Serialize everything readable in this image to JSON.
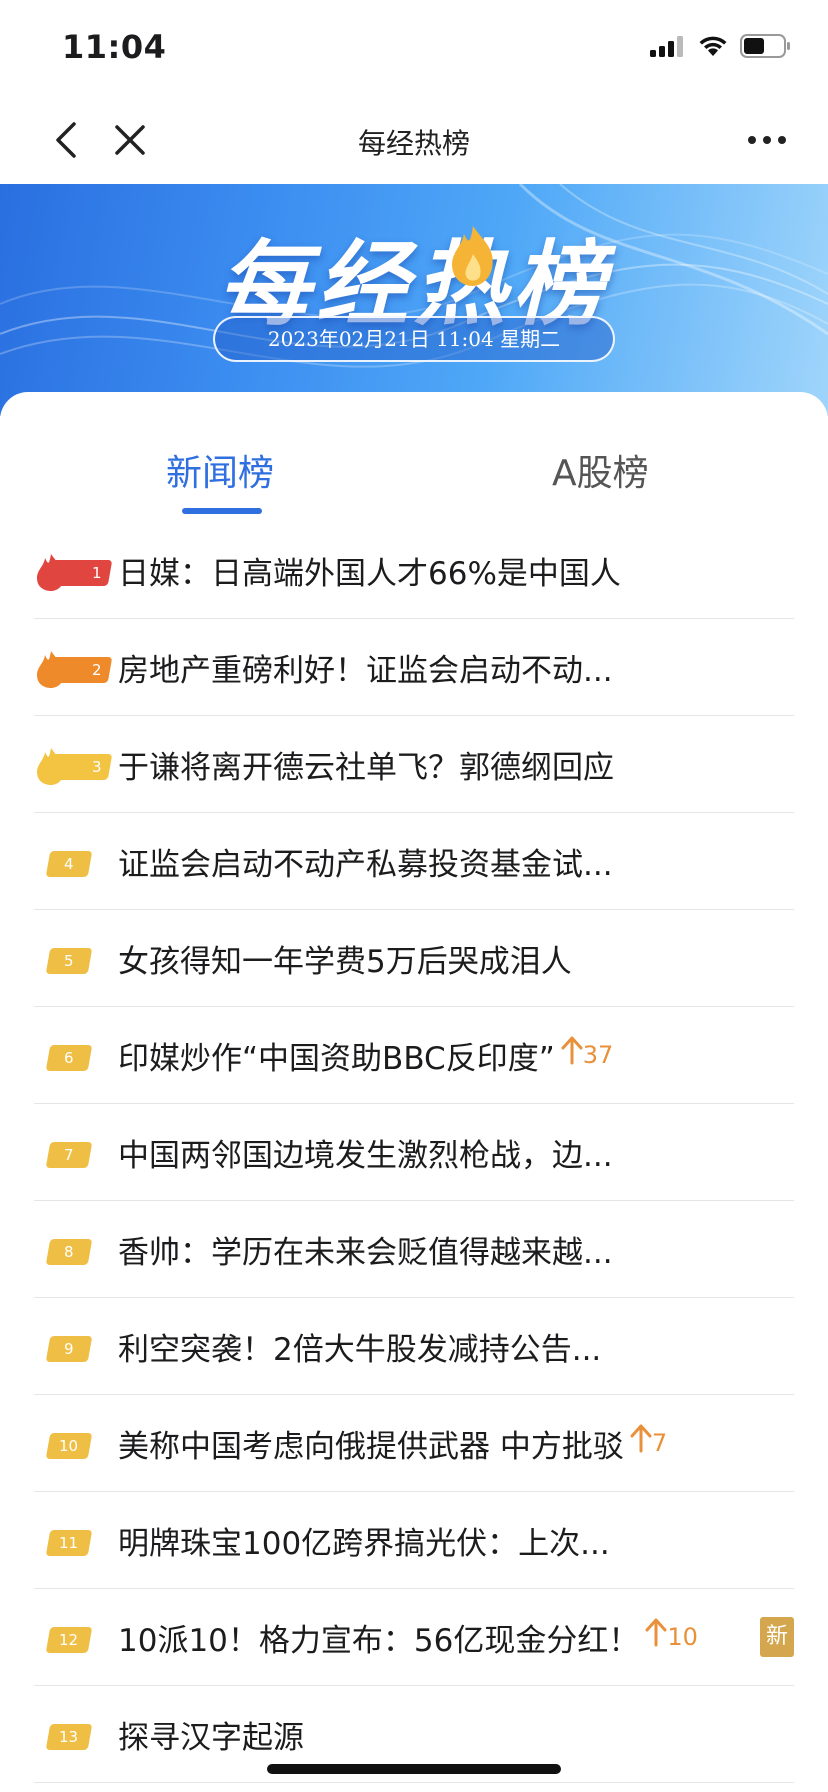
{
  "status_bar": {
    "time": "11:04"
  },
  "nav": {
    "title": "每经热榜"
  },
  "banner": {
    "title": "每经热榜",
    "date": "2023年02月21日 11:04 星期二"
  },
  "tabs": [
    {
      "label": "新闻榜",
      "active": true
    },
    {
      "label": "A股榜",
      "active": false
    }
  ],
  "items": [
    {
      "rank": "1",
      "title": "日媒：日高端外国人才66%是中国人"
    },
    {
      "rank": "2",
      "title": "房地产重磅利好！证监会启动不动..."
    },
    {
      "rank": "3",
      "title": "于谦将离开德云社单飞？郭德纲回应"
    },
    {
      "rank": "4",
      "title": "证监会启动不动产私募投资基金试..."
    },
    {
      "rank": "5",
      "title": "女孩得知一年学费5万后哭成泪人"
    },
    {
      "rank": "6",
      "title": "印媒炒作“中国资助BBC反印度”",
      "trend": "37"
    },
    {
      "rank": "7",
      "title": "中国两邻国边境发生激烈枪战，边..."
    },
    {
      "rank": "8",
      "title": "香帅：学历在未来会贬值得越来越..."
    },
    {
      "rank": "9",
      "title": "利空突袭！2倍大牛股发减持公告..."
    },
    {
      "rank": "10",
      "title": "美称中国考虑向俄提供武器 中方批驳",
      "trend": "7"
    },
    {
      "rank": "11",
      "title": "明牌珠宝100亿跨界搞光伏：上次..."
    },
    {
      "rank": "12",
      "title": "10派10！格力宣布：56亿现金分红！",
      "trend": "10",
      "badge": "新"
    },
    {
      "rank": "13",
      "title": "探寻汉字起源"
    }
  ],
  "colors": {
    "accent": "#2f6fe0",
    "rank1": "#e0453f",
    "rank2": "#ef8a2b",
    "rank3": "#f3c441",
    "rank_other": "#efbf45",
    "trend": "#e9903a",
    "new_badge": "#d4a64e"
  }
}
